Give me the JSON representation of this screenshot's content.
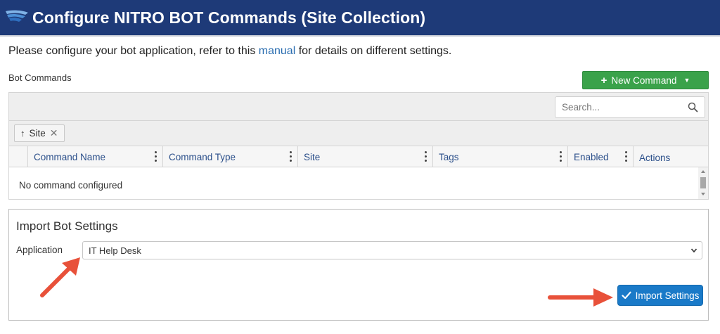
{
  "header": {
    "title": "Configure NITRO BOT Commands (Site Collection)",
    "logo_icon": "nitro-wing-logo",
    "bg_color": "#1e3a78"
  },
  "intro": {
    "prefix": "Please configure your bot application, refer to this ",
    "link": "manual",
    "suffix": " for details on different settings."
  },
  "bot_commands": {
    "label": "Bot Commands",
    "new_command_label": "New Command",
    "new_command_color": "#3aa24a",
    "search_placeholder": "Search...",
    "group_chip": "Site",
    "columns": [
      "Command Name",
      "Command Type",
      "Site",
      "Tags",
      "Enabled",
      "Actions"
    ],
    "empty_message": "No command configured"
  },
  "import": {
    "title": "Import Bot Settings",
    "application_label": "Application",
    "application_value": "IT Help Desk",
    "button_label": "Import Settings",
    "button_color": "#1a7ac8"
  },
  "annotations": {
    "arrow_color": "#e8513a"
  }
}
